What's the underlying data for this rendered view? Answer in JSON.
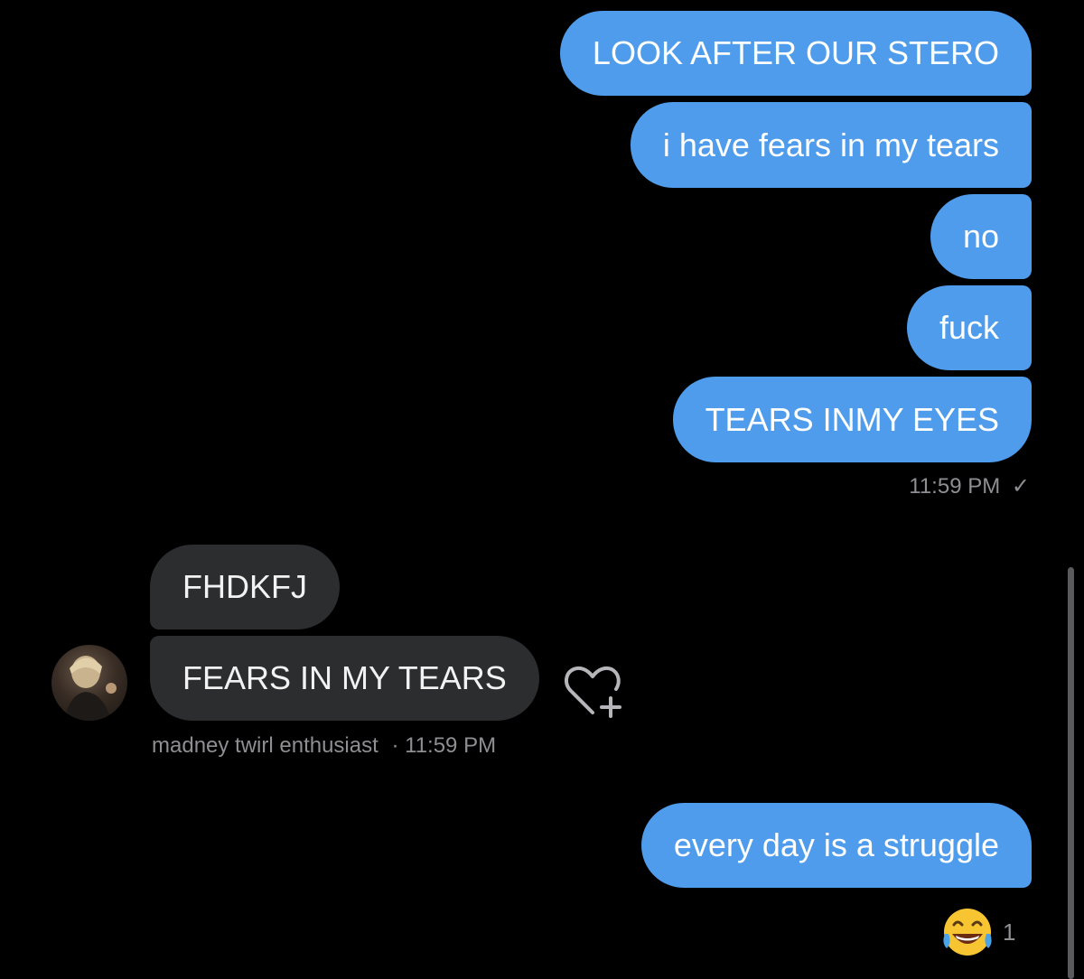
{
  "outgoing_group_1": [
    "LOOK AFTER OUR STERO",
    "i have fears in my tears",
    "no",
    "fuck",
    "TEARS INMY EYES"
  ],
  "outgoing_group_1_time": "11:59 PM",
  "outgoing_group_1_status_glyph": "✓",
  "incoming": {
    "messages": [
      "FHDKFJ",
      "FEARS IN MY TEARS"
    ],
    "sender_name": "madney twirl enthusiast",
    "separator": "·",
    "time": "11:59 PM",
    "avatar_icon": "profile-photo-avatar",
    "action_icon": "heart-plus-icon"
  },
  "outgoing_group_2": [
    "every day is a struggle"
  ],
  "reaction": {
    "emoji": "😂",
    "count": "1"
  },
  "colors": {
    "outgoing_bubble": "#4e9ceb",
    "incoming_bubble": "#2c2d2f",
    "background": "#000000",
    "meta_text": "#8e8e93"
  }
}
